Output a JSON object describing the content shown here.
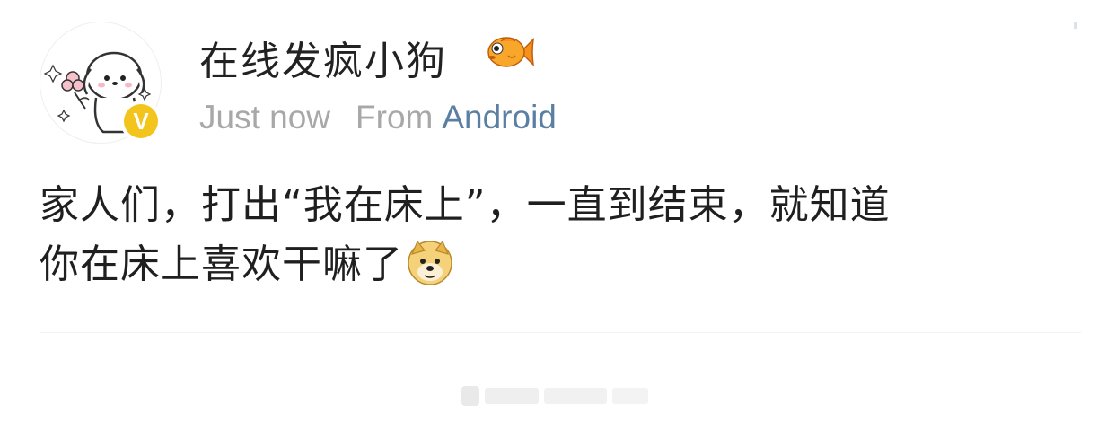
{
  "post": {
    "username": "在线发疯小狗",
    "time": "Just now",
    "from_label": "From",
    "platform": "Android",
    "body_line1": "家人们，打出“我在床上”，一直到结束，就知道",
    "body_line2": "你在床上喜欢干嘛了"
  },
  "icons": {
    "avatar": "cartoon-puppy-avatar",
    "verified": "verified-badge-icon",
    "username_emoji": "goldfish-emoji-icon",
    "body_emoji": "doge-emoji-icon",
    "watermark": "blurred-watermark"
  },
  "colors": {
    "username": "#222222",
    "meta_gray": "#a8a8a8",
    "platform_link": "#5a7fa3",
    "verified_badge": "#f3c41c",
    "body_text": "#1f1f1f"
  }
}
